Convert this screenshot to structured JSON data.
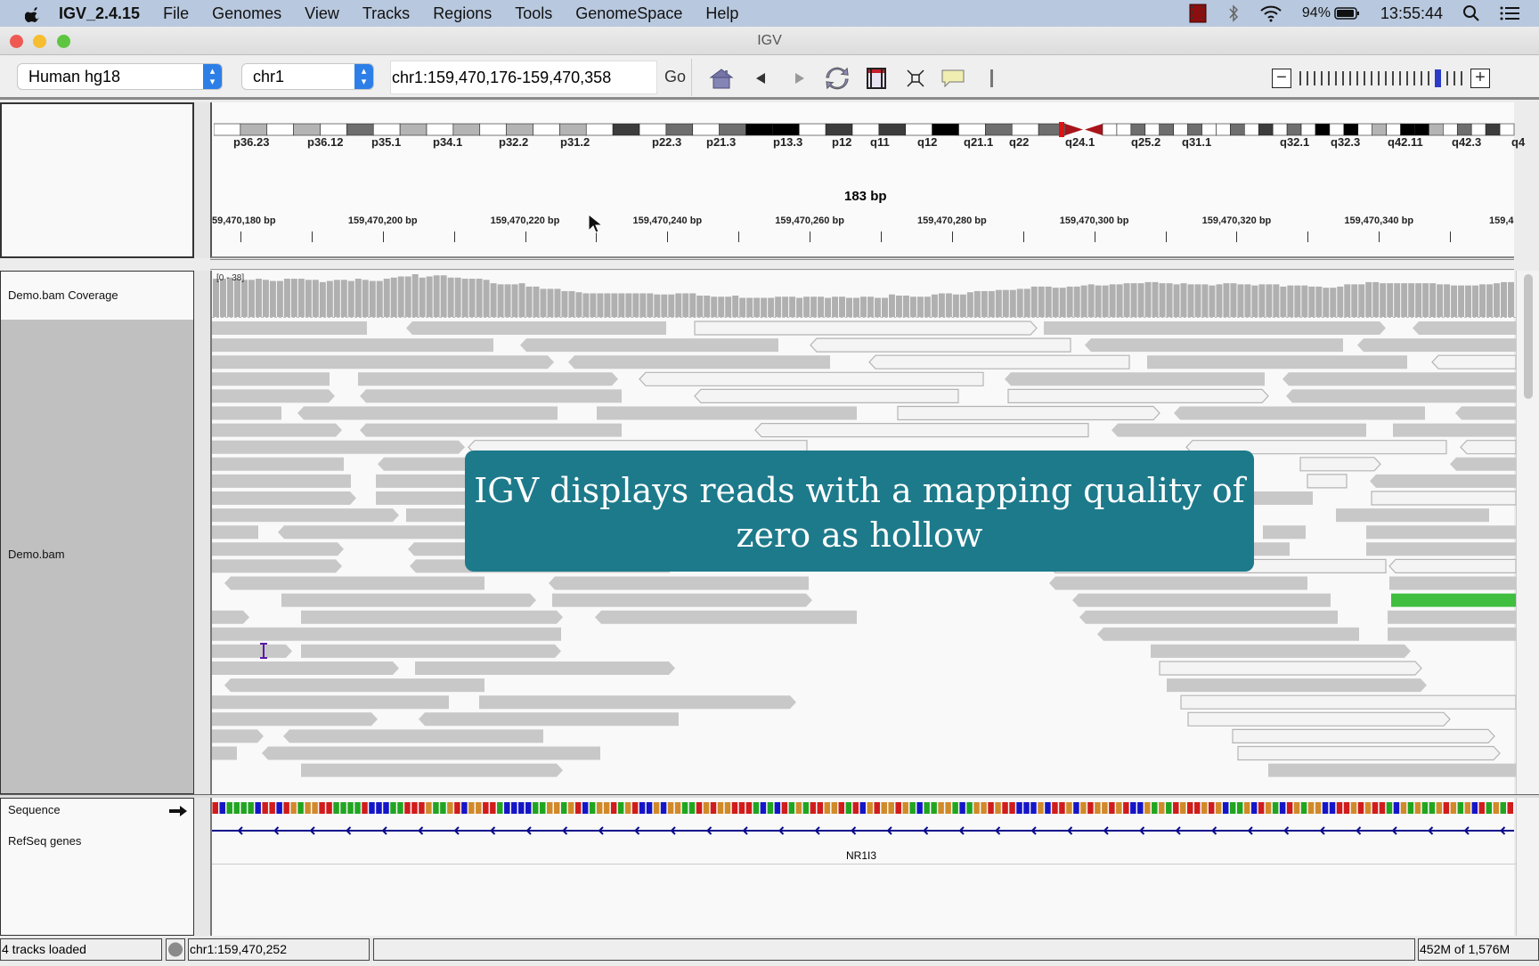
{
  "menubar": {
    "app_name": "IGV_2.4.15",
    "items": [
      "File",
      "Genomes",
      "View",
      "Tracks",
      "Regions",
      "Tools",
      "GenomeSpace",
      "Help"
    ],
    "battery": "94%",
    "clock": "13:55:44"
  },
  "window": {
    "title": "IGV"
  },
  "toolbar": {
    "genome": "Human hg18",
    "chromosome": "chr1",
    "locus": "chr1:159,470,176-159,470,358",
    "go_label": "Go",
    "zoom_level_fraction": 0.87
  },
  "ideogram": {
    "bands": [
      "p36.23",
      "p36.12",
      "p35.1",
      "p34.1",
      "p32.2",
      "p31.2",
      "p22.3",
      "p21.3",
      "p13.3",
      "p12",
      "q11",
      "q12",
      "q21.1",
      "q22",
      "q24.1",
      "q25.2",
      "q31.1",
      "q32.1",
      "q32.3",
      "q42.11",
      "q42.3",
      "q4"
    ]
  },
  "ruler": {
    "span": "183 bp",
    "ticks": [
      "59,470,180 bp",
      "159,470,200 bp",
      "159,470,220 bp",
      "159,470,240 bp",
      "159,470,260 bp",
      "159,470,280 bp",
      "159,470,300 bp",
      "159,470,320 bp",
      "159,470,340 bp",
      "159,4"
    ]
  },
  "tracks": {
    "coverage_name": "Demo.bam Coverage",
    "coverage_range": "[0 - 38]",
    "alignment_name": "Demo.bam",
    "sequence_name": "Sequence",
    "refseq_name": "RefSeq genes",
    "gene_label": "NR1I3"
  },
  "overlay": {
    "text": "IGV displays reads with a mapping quality of zero as hollow"
  },
  "status": {
    "tracks_loaded": "4 tracks loaded",
    "position": "chr1:159,470,252",
    "memory": "452M of 1,576M"
  },
  "colors": {
    "accent": "#1d7a8b",
    "read_fill": "#c8c8c8",
    "hollow_fill": "#f4f4f4",
    "base_A": "#21a521",
    "base_C": "#1515c8",
    "base_G": "#d18a2a",
    "base_T": "#d01c1c",
    "gene": "#0a0a8c"
  }
}
